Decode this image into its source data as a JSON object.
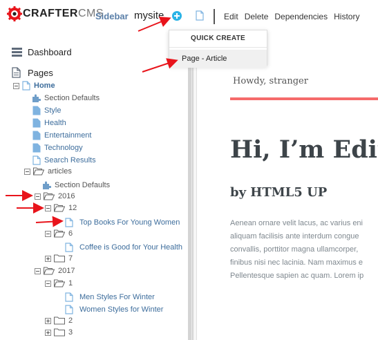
{
  "topbar": {
    "logo_crafter": "CRAFTER",
    "logo_cms": "CMS",
    "sidebar_link": "Sidebar",
    "site_name": "mysite",
    "actions": [
      "Edit",
      "Delete",
      "Dependencies",
      "History"
    ]
  },
  "quick_create": {
    "title": "QUICK CREATE",
    "item": "Page - Article"
  },
  "sidebar": {
    "dashboard": "Dashboard",
    "pages": "Pages",
    "tree": {
      "home": "Home",
      "section_defaults": "Section Defaults",
      "style": "Style",
      "health": "Health",
      "entertainment": "Entertainment",
      "technology": "Technology",
      "search_results": "Search Results",
      "articles": "articles",
      "articles_section_defaults": "Section Defaults",
      "y2016": "2016",
      "m12": "12",
      "top_books": "Top Books For Young Women",
      "m6": "6",
      "coffee": "Coffee is Good for Your Health",
      "m7": "7",
      "y2017": "2017",
      "m1": "1",
      "men_styles": "Men Styles For Winter",
      "women_styles": "Women Styles for Winter",
      "m2": "2",
      "m3": "3"
    }
  },
  "preview": {
    "howdy": "Howdy, stranger",
    "heading": "Hi, I’m Edit",
    "subheading": "by HTML5 UP",
    "paragraph_lines": [
      "Aenean ornare velit lacus, ac varius eni",
      "aliquam facilisis ante interdum congue",
      "convallis, porttitor magna ullamcorper,",
      "finibus nisi nec lacinia. Nam maximus e",
      "Pellentesque sapien ac quam. Lorem ip"
    ]
  },
  "colors": {
    "accent_blue": "#2bb3e6",
    "link_blue": "#3d6d9c",
    "preview_red": "#f56a6a",
    "arrow_red": "#e8141b"
  }
}
